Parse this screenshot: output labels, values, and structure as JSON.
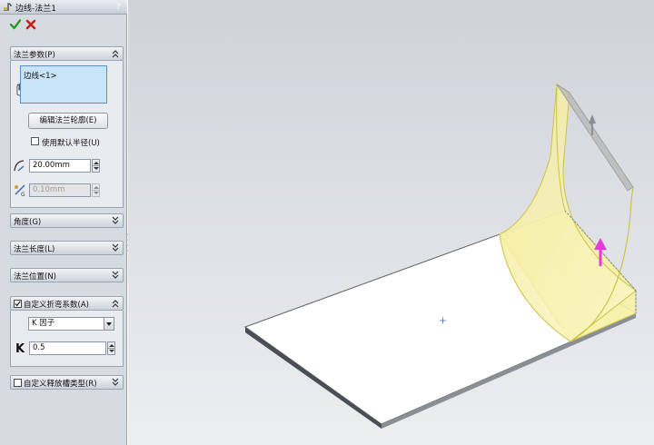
{
  "title": "边线-法兰1",
  "help_label": "?",
  "groups": {
    "flange_params": {
      "label": "法兰参数(P)",
      "selected_edge": "边线<1>",
      "edit_profile_button": "编辑法兰轮廓(E)",
      "use_default_radius_label": "使用默认半径(U)",
      "use_default_radius_checked": false,
      "bend_radius": "20.00mm",
      "gap_distance": "0.10mm",
      "gap_disabled": true
    },
    "angle": {
      "label": "角度(G)",
      "collapsed": true
    },
    "flange_length": {
      "label": "法兰长度(L)",
      "collapsed": true
    },
    "flange_position": {
      "label": "法兰位置(N)",
      "collapsed": true
    },
    "custom_bend_allowance": {
      "label": "自定义折弯系数(A)",
      "checked": true,
      "type": "K 因子",
      "k_symbol": "K",
      "k_value": "0.5"
    },
    "custom_relief": {
      "label": "自定义释放槽类型(R)",
      "checked": false,
      "collapsed": true
    }
  },
  "colors": {
    "panel_bg": "#d6dbe2",
    "selection_blue": "#c9e3f8",
    "preview_yellow": "#f7f1a6",
    "preview_outline": "#d2c84a",
    "drag_arrow": "#e63bd6",
    "ok_green": "#2a9a2a",
    "cancel_red": "#c81e1e"
  },
  "icons": [
    "edge-flange-icon",
    "ok-check-icon",
    "cancel-x-icon",
    "help-icon",
    "edge-select-icon",
    "bend-radius-icon",
    "gap-distance-icon",
    "collapse-chevron-icon",
    "expand-chevron-icon"
  ]
}
